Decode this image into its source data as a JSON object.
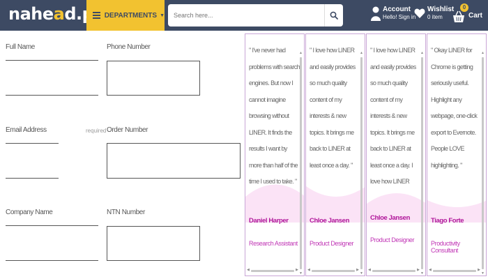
{
  "header": {
    "logo_text_1": "nahe",
    "logo_text_o": "a",
    "logo_text_2": "d.pk",
    "departments_label": "DEPARTMENTS",
    "search_placeholder": "Search here...",
    "account_title": "Account",
    "account_subtitle": "Hello! Sign in",
    "wishlist_title": "Wishlist",
    "wishlist_subtitle": "0 item",
    "cart_label": "Cart",
    "cart_count": "0"
  },
  "form": {
    "full_name_label": "Full Name",
    "phone_label": "Phone Number",
    "email_label": "Email Address",
    "email_required": "required",
    "order_label": "Order Number",
    "company_label": "Company Name",
    "ntn_label": "NTN Number"
  },
  "cards": [
    {
      "quote": "\" I've never had problems with search engines. But now I cannot imagine browsing without LINER. It finds the results I want by more than half of the time I used to take. \"",
      "name": "Daniel Harper",
      "role": "Research Assistant"
    },
    {
      "quote": "\" I love how LINER and easily provides so much quality content of my interests & new topics. It brings me back to LINER at least once a day. \"",
      "name": "Chloe Jansen",
      "role": "Product Designer"
    },
    {
      "quote": "\" I love how LINER and easily provides so much quality content of my interests & new topics. It brings me back to LINER at least once a day. I love how LINER endlessly provides so much quality content of my",
      "name": "Chloe Jansen",
      "role": "Product Designer"
    },
    {
      "quote": "\" Okay LINER for Chrome is getting seriously useful. Highlight any webpage, one-click export to Evernote. People LOVE highlighting. \"",
      "name": "Tiago Forte",
      "role": "Productivity Consultant"
    }
  ],
  "icons": {
    "search": "search-icon",
    "account": "user-icon",
    "wishlist": "heart-icon",
    "cart": "shopping-basket-icon",
    "menu": "hamburger-icon"
  },
  "colors": {
    "header_bg": "#3d4a63",
    "accent": "#f2c230",
    "card_name": "#b0179a",
    "card_border": "#c9a5d6",
    "wave": "#fbe3f6"
  }
}
